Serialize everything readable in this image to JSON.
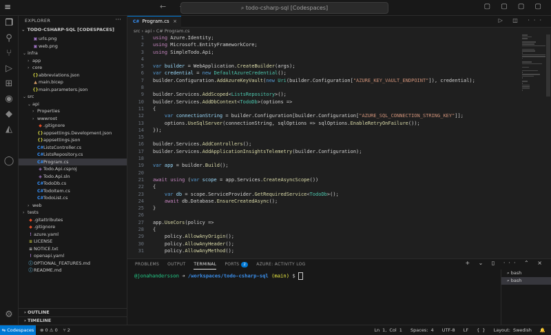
{
  "titlebar": {
    "menu_icon": "≡",
    "nav": "← →",
    "command_center": "⌕ todo-csharp-sql [Codespaces]",
    "window_controls": "▢ ▢ ▢ ▢"
  },
  "activity": {
    "items": [
      "explorer-icon",
      "search-icon",
      "source-control-icon",
      "run-debug-icon",
      "extensions-icon",
      "github-icon",
      "docker-icon",
      "azure-icon",
      "account-icon",
      "settings-icon"
    ],
    "glyphs": [
      "❐",
      "⚲",
      "⑂",
      "▷",
      "⊞",
      "◉",
      "◆",
      "◭",
      "◯",
      "⚙"
    ]
  },
  "sidebar": {
    "title": "EXPLORER",
    "dots": "···",
    "root": "TODO-CSHARP-SQL [CODESPACES]",
    "tree": [
      {
        "label": "urls.png",
        "indent": 1,
        "chev": "",
        "icon": "▣",
        "icolor": "#a074c4"
      },
      {
        "label": "web.png",
        "indent": 1,
        "chev": "",
        "icon": "▣",
        "icolor": "#a074c4"
      },
      {
        "label": "infra",
        "indent": 0,
        "chev": "⌄",
        "icon": "",
        "icolor": ""
      },
      {
        "label": "app",
        "indent": 1,
        "chev": "›",
        "icon": "",
        "icolor": ""
      },
      {
        "label": "core",
        "indent": 1,
        "chev": "›",
        "icon": "",
        "icolor": ""
      },
      {
        "label": "abbreviations.json",
        "indent": 1,
        "chev": "",
        "icon": "{}",
        "icolor": "#cbcb41"
      },
      {
        "label": "main.bicep",
        "indent": 1,
        "chev": "",
        "icon": "▲",
        "icolor": "#d19a66"
      },
      {
        "label": "main.parameters.json",
        "indent": 1,
        "chev": "",
        "icon": "{}",
        "icolor": "#cbcb41"
      },
      {
        "label": "src",
        "indent": 0,
        "chev": "⌄",
        "icon": "",
        "icolor": ""
      },
      {
        "label": "api",
        "indent": 1,
        "chev": "⌄",
        "icon": "",
        "icolor": ""
      },
      {
        "label": "Properties",
        "indent": 2,
        "chev": "›",
        "icon": "",
        "icolor": ""
      },
      {
        "label": "wwwroot",
        "indent": 2,
        "chev": "›",
        "icon": "",
        "icolor": ""
      },
      {
        "label": ".gitignore",
        "indent": 2,
        "chev": "",
        "icon": "◆",
        "icolor": "#e44d26"
      },
      {
        "label": "appsettings.Development.json",
        "indent": 2,
        "chev": "",
        "icon": "{}",
        "icolor": "#cbcb41"
      },
      {
        "label": "appsettings.json",
        "indent": 2,
        "chev": "",
        "icon": "{}",
        "icolor": "#cbcb41"
      },
      {
        "label": "ListsController.cs",
        "indent": 2,
        "chev": "",
        "icon": "C#",
        "icolor": "#3794ff"
      },
      {
        "label": "ListsRepository.cs",
        "indent": 2,
        "chev": "",
        "icon": "C#",
        "icolor": "#3794ff"
      },
      {
        "label": "Program.cs",
        "indent": 2,
        "chev": "",
        "icon": "C#",
        "icolor": "#3794ff",
        "selected": true
      },
      {
        "label": "Todo.Api.csproj",
        "indent": 2,
        "chev": "",
        "icon": "◈",
        "icolor": "#a074c4"
      },
      {
        "label": "Todo.Api.sln",
        "indent": 2,
        "chev": "",
        "icon": "◈",
        "icolor": "#a074c4"
      },
      {
        "label": "TodoDb.cs",
        "indent": 2,
        "chev": "",
        "icon": "C#",
        "icolor": "#3794ff"
      },
      {
        "label": "TodoItem.cs",
        "indent": 2,
        "chev": "",
        "icon": "C#",
        "icolor": "#3794ff"
      },
      {
        "label": "TodoList.cs",
        "indent": 2,
        "chev": "",
        "icon": "C#",
        "icolor": "#3794ff"
      },
      {
        "label": "web",
        "indent": 1,
        "chev": "›",
        "icon": "",
        "icolor": ""
      },
      {
        "label": "tests",
        "indent": 0,
        "chev": "›",
        "icon": "",
        "icolor": ""
      },
      {
        "label": ".gitattributes",
        "indent": 0,
        "chev": "",
        "icon": "◆",
        "icolor": "#e44d26"
      },
      {
        "label": ".gitignore",
        "indent": 0,
        "chev": "",
        "icon": "◆",
        "icolor": "#e44d26"
      },
      {
        "label": "azure.yaml",
        "indent": 0,
        "chev": "",
        "icon": "!",
        "icolor": "#a074c4"
      },
      {
        "label": "LICENSE",
        "indent": 0,
        "chev": "",
        "icon": "≡",
        "icolor": "#cbcb41"
      },
      {
        "label": "NOTICE.txt",
        "indent": 0,
        "chev": "",
        "icon": "≡",
        "icolor": "#cccccc"
      },
      {
        "label": "openapi.yaml",
        "indent": 0,
        "chev": "",
        "icon": "!",
        "icolor": "#a074c4"
      },
      {
        "label": "OPTIONAL_FEATURES.md",
        "indent": 0,
        "chev": "",
        "icon": "ⓘ",
        "icolor": "#519aba"
      },
      {
        "label": "README.md",
        "indent": 0,
        "chev": "",
        "icon": "ⓘ",
        "icolor": "#519aba"
      }
    ],
    "outline": "OUTLINE",
    "timeline": "TIMELINE"
  },
  "editor": {
    "tab_icon": "C#",
    "tab_label": "Program.cs",
    "tab_close": "×",
    "tab_tools": "▷ ◫ ···",
    "breadcrumbs": "src › api › C# Program.cs",
    "lines": [
      [
        [
          "using ",
          "#c586c0"
        ],
        [
          "Azure.Identity",
          ""
        ],
        [
          ";",
          ""
        ]
      ],
      [
        [
          "using ",
          "#c586c0"
        ],
        [
          "Microsoft.EntityFrameworkCore",
          ""
        ],
        [
          ";",
          ""
        ]
      ],
      [
        [
          "using ",
          "#c586c0"
        ],
        [
          "SimpleTodo.Api",
          ""
        ],
        [
          ";",
          ""
        ]
      ],
      [],
      [
        [
          "var ",
          "#569cd6"
        ],
        [
          "builder",
          "#9cdcfe"
        ],
        [
          " = WebApplication.",
          ""
        ],
        [
          "CreateBuilder",
          "#dcdcaa"
        ],
        [
          "(args);",
          ""
        ]
      ],
      [
        [
          "var ",
          "#569cd6"
        ],
        [
          "credential",
          "#9cdcfe"
        ],
        [
          " = ",
          ""
        ],
        [
          "new ",
          "#569cd6"
        ],
        [
          "DefaultAzureCredential",
          "#4ec9b0"
        ],
        [
          "();",
          ""
        ]
      ],
      [
        [
          "builder.Configuration.",
          ""
        ],
        [
          "AddAzureKeyVault",
          "#dcdcaa"
        ],
        [
          "(",
          ""
        ],
        [
          "new ",
          "#569cd6"
        ],
        [
          "Uri",
          "#4ec9b0"
        ],
        [
          "(builder.Configuration[",
          ""
        ],
        [
          "\"AZURE_KEY_VAULT_ENDPOINT\"",
          "#ce9178"
        ],
        [
          "]), credential);",
          ""
        ]
      ],
      [],
      [
        [
          "builder.Services.",
          ""
        ],
        [
          "AddScoped",
          "#dcdcaa"
        ],
        [
          "<",
          ""
        ],
        [
          "ListsRepository",
          "#4ec9b0"
        ],
        [
          ">();",
          ""
        ]
      ],
      [
        [
          "builder.Services.",
          ""
        ],
        [
          "AddDbContext",
          "#dcdcaa"
        ],
        [
          "<",
          ""
        ],
        [
          "TodoDb",
          "#4ec9b0"
        ],
        [
          ">(options =>",
          ""
        ]
      ],
      [
        [
          "{",
          ""
        ]
      ],
      [
        [
          "    ",
          ""
        ],
        [
          "var ",
          "#569cd6"
        ],
        [
          "connectionString",
          "#9cdcfe"
        ],
        [
          " = builder.Configuration[builder.Configuration[",
          ""
        ],
        [
          "\"AZURE_SQL_CONNECTION_STRING_KEY\"",
          "#ce9178"
        ],
        [
          "]];",
          ""
        ]
      ],
      [
        [
          "    options.",
          ""
        ],
        [
          "UseSqlServer",
          "#dcdcaa"
        ],
        [
          "(connectionString, sqlOptions => sqlOptions.",
          ""
        ],
        [
          "EnableRetryOnFailure",
          "#dcdcaa"
        ],
        [
          "());",
          ""
        ]
      ],
      [
        [
          "});",
          ""
        ]
      ],
      [],
      [
        [
          "builder.Services.",
          ""
        ],
        [
          "AddControllers",
          "#dcdcaa"
        ],
        [
          "();",
          ""
        ]
      ],
      [
        [
          "builder.Services.",
          ""
        ],
        [
          "AddApplicationInsightsTelemetry",
          "#dcdcaa"
        ],
        [
          "(builder.Configuration);",
          ""
        ]
      ],
      [],
      [
        [
          "var ",
          "#569cd6"
        ],
        [
          "app",
          "#9cdcfe"
        ],
        [
          " = builder.",
          ""
        ],
        [
          "Build",
          "#dcdcaa"
        ],
        [
          "();",
          ""
        ]
      ],
      [],
      [
        [
          "await ",
          "#c586c0"
        ],
        [
          "using ",
          "#c586c0"
        ],
        [
          "(",
          ""
        ],
        [
          "var ",
          "#569cd6"
        ],
        [
          "scope",
          "#9cdcfe"
        ],
        [
          " = app.Services.",
          ""
        ],
        [
          "CreateAsyncScope",
          "#dcdcaa"
        ],
        [
          "())",
          ""
        ]
      ],
      [
        [
          "{",
          ""
        ]
      ],
      [
        [
          "    ",
          ""
        ],
        [
          "var ",
          "#569cd6"
        ],
        [
          "db",
          "#9cdcfe"
        ],
        [
          " = scope.ServiceProvider.",
          ""
        ],
        [
          "GetRequiredService",
          "#dcdcaa"
        ],
        [
          "<",
          ""
        ],
        [
          "TodoDb",
          "#4ec9b0"
        ],
        [
          ">();",
          ""
        ]
      ],
      [
        [
          "    ",
          ""
        ],
        [
          "await ",
          "#c586c0"
        ],
        [
          "db.Database.",
          ""
        ],
        [
          "EnsureCreatedAsync",
          "#dcdcaa"
        ],
        [
          "();",
          ""
        ]
      ],
      [
        [
          "}",
          ""
        ]
      ],
      [],
      [
        [
          "app.",
          ""
        ],
        [
          "UseCors",
          "#dcdcaa"
        ],
        [
          "(policy =>",
          ""
        ]
      ],
      [
        [
          "{",
          ""
        ]
      ],
      [
        [
          "    policy.",
          ""
        ],
        [
          "AllowAnyOrigin",
          "#dcdcaa"
        ],
        [
          "();",
          ""
        ]
      ],
      [
        [
          "    policy.",
          ""
        ],
        [
          "AllowAnyHeader",
          "#dcdcaa"
        ],
        [
          "();",
          ""
        ]
      ],
      [
        [
          "    policy.",
          ""
        ],
        [
          "AllowAnyMethod",
          "#dcdcaa"
        ],
        [
          "();",
          ""
        ]
      ],
      [
        [
          "});",
          ""
        ]
      ]
    ]
  },
  "panel": {
    "tabs": [
      "PROBLEMS",
      "OUTPUT",
      "TERMINAL",
      "PORTS",
      "AZURE: ACTIVITY LOG"
    ],
    "active": "TERMINAL",
    "ports_badge": "2",
    "tools": "+ ⌄ ▯ ··· ⌃ ×",
    "prompt_user": "@jonahandersson",
    "prompt_arrow": " ➜ ",
    "prompt_path": "/workspaces/todo-csharp-sql",
    "prompt_branch": " (main)",
    "prompt_end": " $ ",
    "terminals": [
      "⌕ bash",
      "⌕ bash"
    ]
  },
  "status": {
    "remote": "⇆ Codespaces",
    "problems": "⊗ 0 ⚠ 0",
    "ports": "⑂ 2",
    "position": "Ln 1, Col 1",
    "spaces": "Spaces: 4",
    "encoding": "UTF-8",
    "eol": "LF",
    "lang_icon": "{ }",
    "layout": "Layout: Swedish",
    "bell": "🔔"
  }
}
